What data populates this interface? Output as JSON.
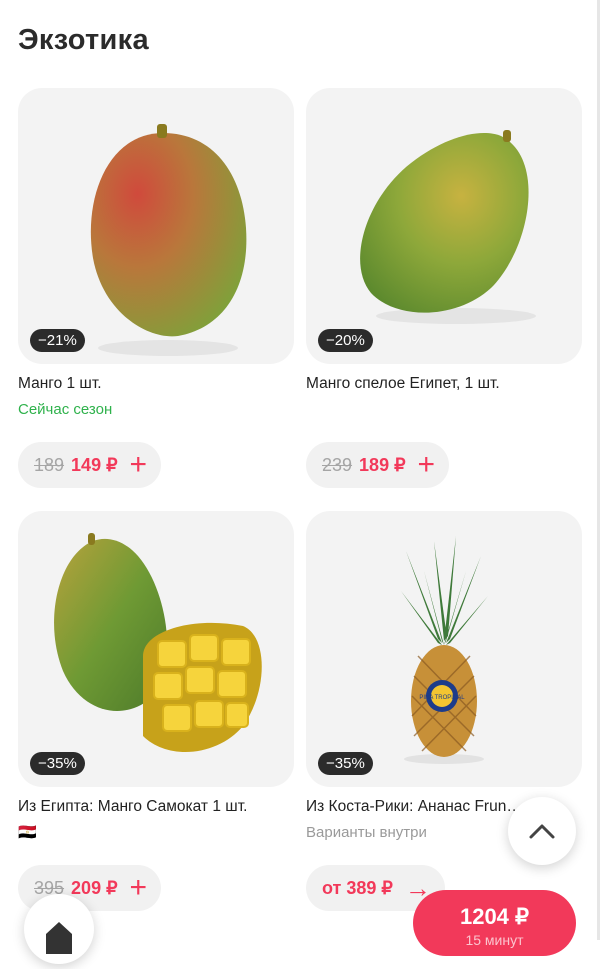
{
  "section": {
    "title": "Экзотика"
  },
  "products": [
    {
      "discount": "−21%",
      "name": "Манго 1 шт.",
      "subtitle": "Сейчас сезон",
      "old_price": "189",
      "price": "149 ₽",
      "action": "+"
    },
    {
      "discount": "−20%",
      "name": "Манго спелое Египет, 1 шт.",
      "subtitle": "",
      "old_price": "239",
      "price": "189 ₽",
      "action": "+"
    },
    {
      "discount": "−35%",
      "name": "Из Египта: Манго Самокат 1 шт.",
      "subtitle": "🇪🇬",
      "old_price": "395",
      "price": "209 ₽",
      "action": "+"
    },
    {
      "discount": "−35%",
      "name": "Из Коста-Рики: Ананас Frun…",
      "subtitle": "Варианты внутри",
      "old_price": "",
      "price": "от 389 ₽",
      "action": "→"
    }
  ],
  "pineapple_label": "PIÑA TROPICAL",
  "cart": {
    "total": "1204 ₽",
    "eta": "15 минут"
  },
  "icons": {
    "scroll_up": "chevron-up-icon",
    "home": "home-icon",
    "add": "plus-icon",
    "more": "arrow-right-icon"
  },
  "colors": {
    "accent": "#f2395a",
    "season": "#2fb24c",
    "badge": "#2b2b2b"
  }
}
